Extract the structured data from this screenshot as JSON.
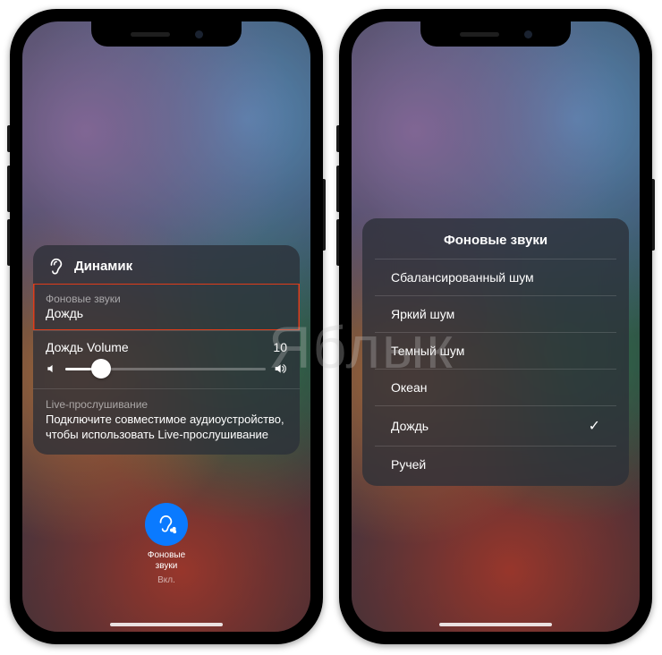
{
  "left": {
    "panel_title": "Динамик",
    "bg_section_label": "Фоновые звуки",
    "bg_section_value": "Дождь",
    "volume_label": "Дождь Volume",
    "volume_value": "10",
    "live_label": "Live-прослушивание",
    "live_desc": "Подключите совместимое аудиоустройство, чтобы использовать Live-прослушивание",
    "cc_button_line1": "Фоновые",
    "cc_button_line2": "звуки",
    "cc_button_state": "Вкл."
  },
  "right": {
    "menu_title": "Фоновые звуки",
    "items": [
      {
        "label": "Сбалансированный шум",
        "selected": false
      },
      {
        "label": "Яркий шум",
        "selected": false
      },
      {
        "label": "Темный шум",
        "selected": false
      },
      {
        "label": "Океан",
        "selected": false
      },
      {
        "label": "Дождь",
        "selected": true
      },
      {
        "label": "Ручей",
        "selected": false
      }
    ]
  },
  "watermark": "Яблык"
}
